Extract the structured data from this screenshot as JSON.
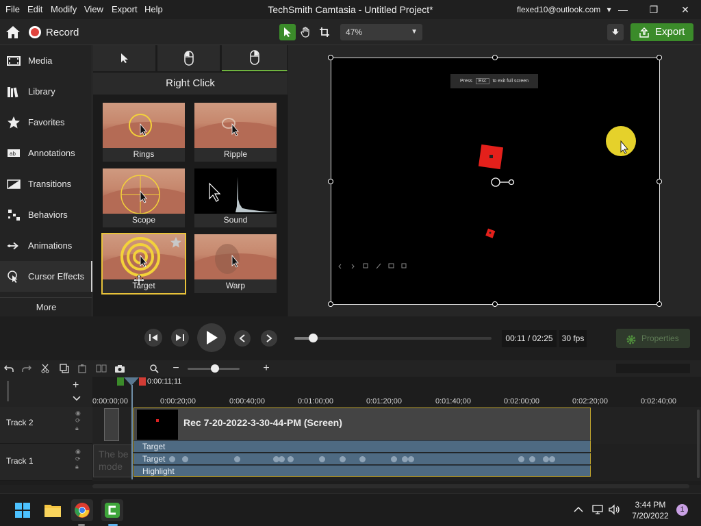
{
  "window": {
    "title": "TechSmith Camtasia - Untitled Project*",
    "menu": [
      "File",
      "Edit",
      "Modify",
      "View",
      "Export",
      "Help"
    ],
    "account": "flexed10@outlook.com",
    "account_caret": "▾",
    "minimize": "—",
    "restore": "❐",
    "close": "✕"
  },
  "toolbar": {
    "record_label": "Record",
    "zoom": "47%",
    "export_label": "Export"
  },
  "sidebar": {
    "items": [
      {
        "label": "Media",
        "icon": "filmstrip-icon"
      },
      {
        "label": "Library",
        "icon": "books-icon"
      },
      {
        "label": "Favorites",
        "icon": "star-icon"
      },
      {
        "label": "Annotations",
        "icon": "annotation-icon"
      },
      {
        "label": "Transitions",
        "icon": "transition-icon"
      },
      {
        "label": "Behaviors",
        "icon": "behaviors-icon"
      },
      {
        "label": "Animations",
        "icon": "animation-arrow-icon"
      },
      {
        "label": "Cursor Effects",
        "icon": "cursor-effects-icon"
      }
    ],
    "more_label": "More"
  },
  "effects": {
    "heading": "Right Click",
    "tiles": [
      {
        "label": "Rings"
      },
      {
        "label": "Ripple"
      },
      {
        "label": "Scope"
      },
      {
        "label": "Sound"
      },
      {
        "label": "Target"
      },
      {
        "label": "Warp"
      }
    ]
  },
  "preview": {
    "esc_hint_prefix": "Press",
    "esc_key": "Esc",
    "esc_hint_suffix": "to exit full screen"
  },
  "playback": {
    "time": "00:11 / 02:25",
    "fps": "30 fps",
    "properties_label": "Properties"
  },
  "timeline": {
    "playhead_time": "0:00:11;11",
    "ticks": [
      "0:00:00;00",
      "0:00:20;00",
      "0:00:40;00",
      "0:01:00;00",
      "0:01:20;00",
      "0:01:40;00",
      "0:02:00;00",
      "0:02:20;00",
      "0:02:40;00"
    ],
    "tracks": [
      {
        "name": "Track 2"
      },
      {
        "name": "Track 1"
      }
    ],
    "clip_title": "Rec 7-20-2022-3-30-44-PM (Screen)",
    "effect_rows": [
      "Target",
      "Target",
      "Highlight"
    ],
    "ghost_text": [
      "The be",
      "mode"
    ]
  },
  "taskbar": {
    "time": "3:44 PM",
    "date": "7/20/2022",
    "notification_count": "1"
  },
  "colors": {
    "accent_green": "#3b8b2a",
    "record_red": "#e0443e",
    "selection_yellow": "#e8c23a",
    "effect_blue": "#4e6a82"
  }
}
